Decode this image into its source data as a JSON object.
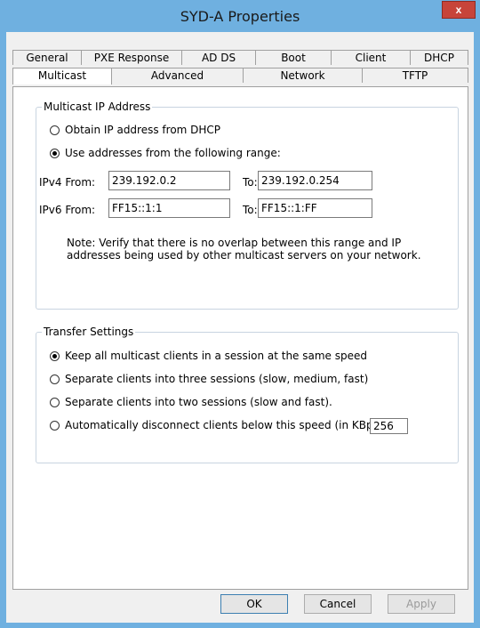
{
  "window": {
    "title": "SYD-A Properties",
    "close_glyph": "x"
  },
  "tabs": {
    "row1": [
      "General",
      "PXE Response",
      "AD DS",
      "Boot",
      "Client",
      "DHCP"
    ],
    "row2": [
      "Multicast",
      "Advanced",
      "Network",
      "TFTP"
    ],
    "active": "Multicast"
  },
  "multicast_ip": {
    "legend": "Multicast IP Address",
    "obtain_dhcp_label": "Obtain IP address from DHCP",
    "use_range_label": "Use addresses from the following range:",
    "selected": "use_range",
    "ipv4_label": "IPv4  From:",
    "ipv4_from": "239.192.0.2",
    "ipv4_to_label": "To:",
    "ipv4_to": "239.192.0.254",
    "ipv6_label": "IPv6  From:",
    "ipv6_from": "FF15::1:1",
    "ipv6_to_label": "To:",
    "ipv6_to": "FF15::1:FF",
    "note_line1": "Note: Verify that there is no overlap between this range and IP",
    "note_line2": "addresses being used by other multicast servers on your network."
  },
  "transfer": {
    "legend": "Transfer Settings",
    "opt_same_speed": "Keep all multicast clients in a session at the same speed",
    "opt_three": "Separate clients into three sessions (slow, medium, fast)",
    "opt_two": "Separate clients into two sessions (slow and fast).",
    "opt_disconnect": "Automatically disconnect clients below this speed (in KBps):",
    "disconnect_speed": "256",
    "selected": "same_speed"
  },
  "buttons": {
    "ok": "OK",
    "cancel": "Cancel",
    "apply": "Apply"
  }
}
